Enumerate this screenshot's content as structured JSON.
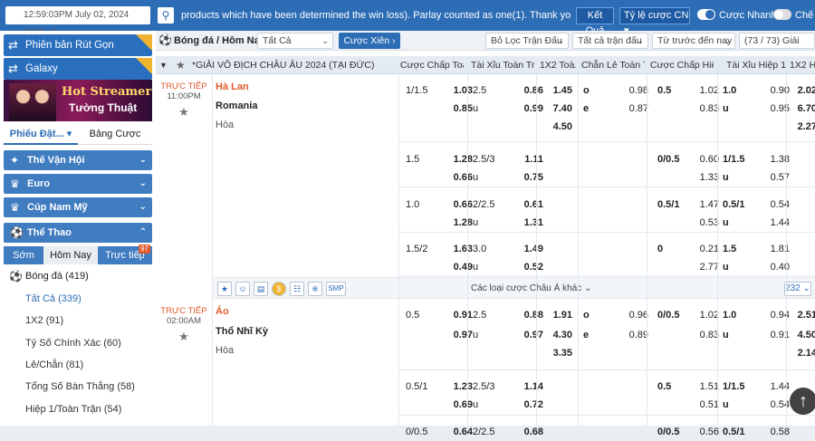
{
  "topbar": {
    "time": "12:59:03PM July 02, 2024 GMT +7",
    "marquee": "products which have been determined the win loss). Parlay counted as one(1). Thank you!",
    "results_button": "Kết Quả",
    "odds_type": "Tỷ lệ cược CN",
    "quick_bet_label": "Cược Nhanh",
    "mode_label": "Chế đ"
  },
  "sidebar": {
    "promo1": "Phiên bản Rút Gọn",
    "promo2": "Galaxy",
    "new_badge": "NEW",
    "banner_line1": "Hot Streamer",
    "banner_line2": "Tường Thuật",
    "tab_betslip": "Phiếu Đặt...",
    "tab_mybets": "Bảng Cược",
    "categories": [
      "Thế Vận Hội",
      "Euro",
      "Cúp Nam Mỹ",
      "Thể Thao"
    ],
    "subtabs": [
      "Sớm",
      "Hôm Nay",
      "Trực tiếp"
    ],
    "live_count": "97",
    "sport": "Bóng đá",
    "sport_count": "(419)",
    "markets": [
      {
        "label": "Tất Cả",
        "count": "(339)"
      },
      {
        "label": "1X2",
        "count": "(91)"
      },
      {
        "label": "Tỷ Số Chính Xác",
        "count": "(60)"
      },
      {
        "label": "Lẻ/Chẵn",
        "count": "(81)"
      },
      {
        "label": "Tổng Số Bàn Thắng",
        "count": "(58)"
      },
      {
        "label": "Hiệp 1/Toàn Trận",
        "count": "(54)"
      }
    ]
  },
  "filters": {
    "title": "Bóng đá / Hôm Nay",
    "all": "Tất Cả",
    "parlay": "Cược Xiên",
    "league_filter": "Bỏ Lọc Trận Đấu",
    "all_matches": "Tất cả trận đấu",
    "sort": "Từ trước đến nay",
    "count": "(73 / 73) Giải"
  },
  "table": {
    "league": "*GIẢI VÔ ĐỊCH CHÂU ÂU 2024 (TẠI ĐỨC)",
    "headers": [
      "Cược Chấp Toà...",
      "Tài Xỉu Toàn Trận",
      "1X2 Toà...",
      "Chẵn Lẻ Toàn T...",
      "Cược Chấp Hiệ...",
      "Tài Xỉu Hiệp 1",
      "1X2 Hiệ"
    ],
    "other_bets": "Các loại cược Châu Á khác",
    "more_count": "232",
    "matches": [
      {
        "status": "TRỰC TIẾP",
        "time": "11:00PM",
        "home": "Hà Lan",
        "away": "Romania",
        "draw": "Hòa",
        "rows": [
          [
            "1/1.5",
            "1.03",
            "2.5",
            "0.86",
            "1.45",
            "o",
            "0.98",
            "0.5",
            "1.02",
            "1.0",
            "0.90",
            "2.02"
          ],
          [
            "",
            "0.85",
            "u",
            "0.99",
            "7.40",
            "e",
            "0.87",
            "",
            "0.83",
            "u",
            "0.95",
            "6.70"
          ],
          [
            "",
            "",
            "",
            "",
            "4.50",
            "",
            "",
            "",
            "",
            "",
            "",
            "2.27"
          ],
          [
            "1.5",
            "1.28",
            "2.5/3",
            "1.11",
            "",
            "",
            "",
            "0/0.5",
            "0.60",
            "1/1.5",
            "1.38",
            ""
          ],
          [
            "",
            "0.66",
            "u",
            "0.75",
            "",
            "",
            "",
            "",
            "1.33",
            "u",
            "0.57",
            ""
          ],
          [
            "1.0",
            "0.66",
            "2/2.5",
            "0.61",
            "",
            "",
            "",
            "0.5/1",
            "1.47",
            "0.5/1",
            "0.54",
            ""
          ],
          [
            "",
            "1.28",
            "u",
            "1.31",
            "",
            "",
            "",
            "",
            "0.53",
            "u",
            "1.44",
            ""
          ],
          [
            "1.5/2",
            "1.63",
            "3.0",
            "1.49",
            "",
            "",
            "",
            "0",
            "0.21",
            "1.5",
            "1.81",
            ""
          ],
          [
            "",
            "0.49",
            "u",
            "0.52",
            "",
            "",
            "",
            "",
            "2.77",
            "u",
            "0.40",
            ""
          ]
        ]
      },
      {
        "status": "TRỰC TIẾP",
        "time": "02:00AM",
        "home": "Áo",
        "away": "Thổ Nhĩ Kỳ",
        "draw": "Hòa",
        "rows": [
          [
            "0.5",
            "0.91",
            "2.5",
            "0.88",
            "1.91",
            "o",
            "0.96",
            "0/0.5",
            "1.02",
            "1.0",
            "0.94",
            "2.51"
          ],
          [
            "",
            "0.97",
            "u",
            "0.97",
            "4.30",
            "e",
            "0.89",
            "",
            "0.83",
            "u",
            "0.91",
            "4.50"
          ],
          [
            "",
            "",
            "",
            "",
            "3.35",
            "",
            "",
            "",
            "",
            "",
            "",
            "2.14"
          ],
          [
            "0.5/1",
            "1.23",
            "2.5/3",
            "1.14",
            "",
            "",
            "",
            "0.5",
            "1.51",
            "1/1.5",
            "1.44",
            ""
          ],
          [
            "",
            "0.69",
            "u",
            "0.72",
            "",
            "",
            "",
            "",
            "0.51",
            "u",
            "0.54",
            ""
          ],
          [
            "0/0.5",
            "0.64",
            "2/2.5",
            "0.68",
            "",
            "",
            "",
            "0/0.5",
            "0.56",
            "0.5/1",
            "0.58",
            ""
          ]
        ]
      }
    ]
  }
}
